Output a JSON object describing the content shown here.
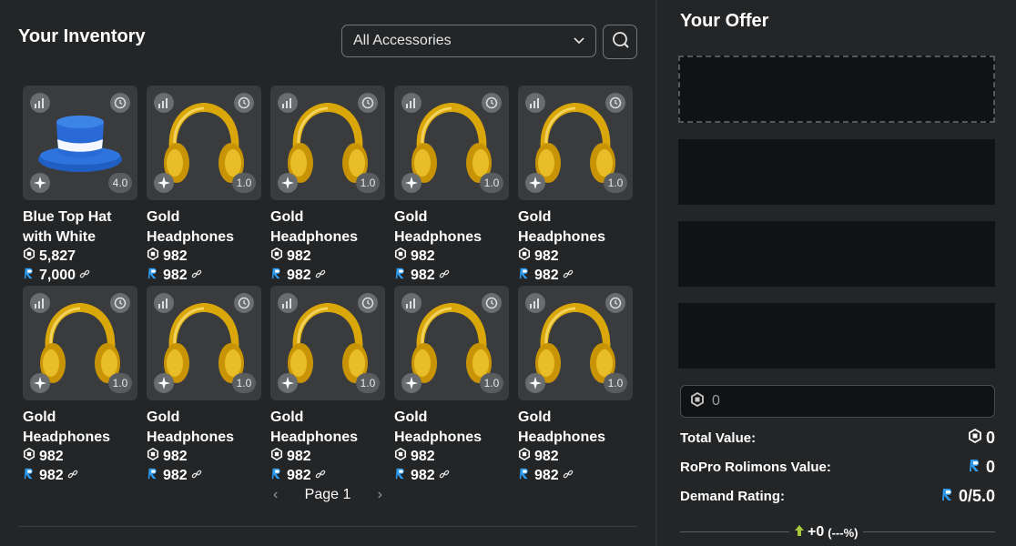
{
  "inventory": {
    "title": "Your Inventory",
    "filter_selected": "All Accessories",
    "items": [
      {
        "name": "Blue Top Hat with White",
        "rap": "4.0",
        "robux": "5,827",
        "rolimons": "7,000",
        "kind": "hat"
      },
      {
        "name": "Gold Headphones",
        "rap": "1.0",
        "robux": "982",
        "rolimons": "982",
        "kind": "headphones"
      },
      {
        "name": "Gold Headphones",
        "rap": "1.0",
        "robux": "982",
        "rolimons": "982",
        "kind": "headphones"
      },
      {
        "name": "Gold Headphones",
        "rap": "1.0",
        "robux": "982",
        "rolimons": "982",
        "kind": "headphones"
      },
      {
        "name": "Gold Headphones",
        "rap": "1.0",
        "robux": "982",
        "rolimons": "982",
        "kind": "headphones"
      },
      {
        "name": "Gold Headphones",
        "rap": "1.0",
        "robux": "982",
        "rolimons": "982",
        "kind": "headphones"
      },
      {
        "name": "Gold Headphones",
        "rap": "1.0",
        "robux": "982",
        "rolimons": "982",
        "kind": "headphones"
      },
      {
        "name": "Gold Headphones",
        "rap": "1.0",
        "robux": "982",
        "rolimons": "982",
        "kind": "headphones"
      },
      {
        "name": "Gold Headphones",
        "rap": "1.0",
        "robux": "982",
        "rolimons": "982",
        "kind": "headphones"
      },
      {
        "name": "Gold Headphones",
        "rap": "1.0",
        "robux": "982",
        "rolimons": "982",
        "kind": "headphones"
      }
    ],
    "pager": {
      "label": "Page 1"
    }
  },
  "offer": {
    "title": "Your Offer",
    "robux_input_value": "0",
    "total_value_label": "Total Value:",
    "total_value": "0",
    "rolimons_label": "RoPro Rolimons Value:",
    "rolimons_value": "0",
    "demand_label": "Demand Rating:",
    "demand_value": "0/5.0",
    "summary_value": "+0",
    "summary_percent": "(---%)"
  },
  "colors": {
    "background": "#232527",
    "slot": "#111214",
    "rolimons_blue": "#2e9bf0",
    "gold": "#d9a70a",
    "hat_blue": "#1f5fc4"
  }
}
